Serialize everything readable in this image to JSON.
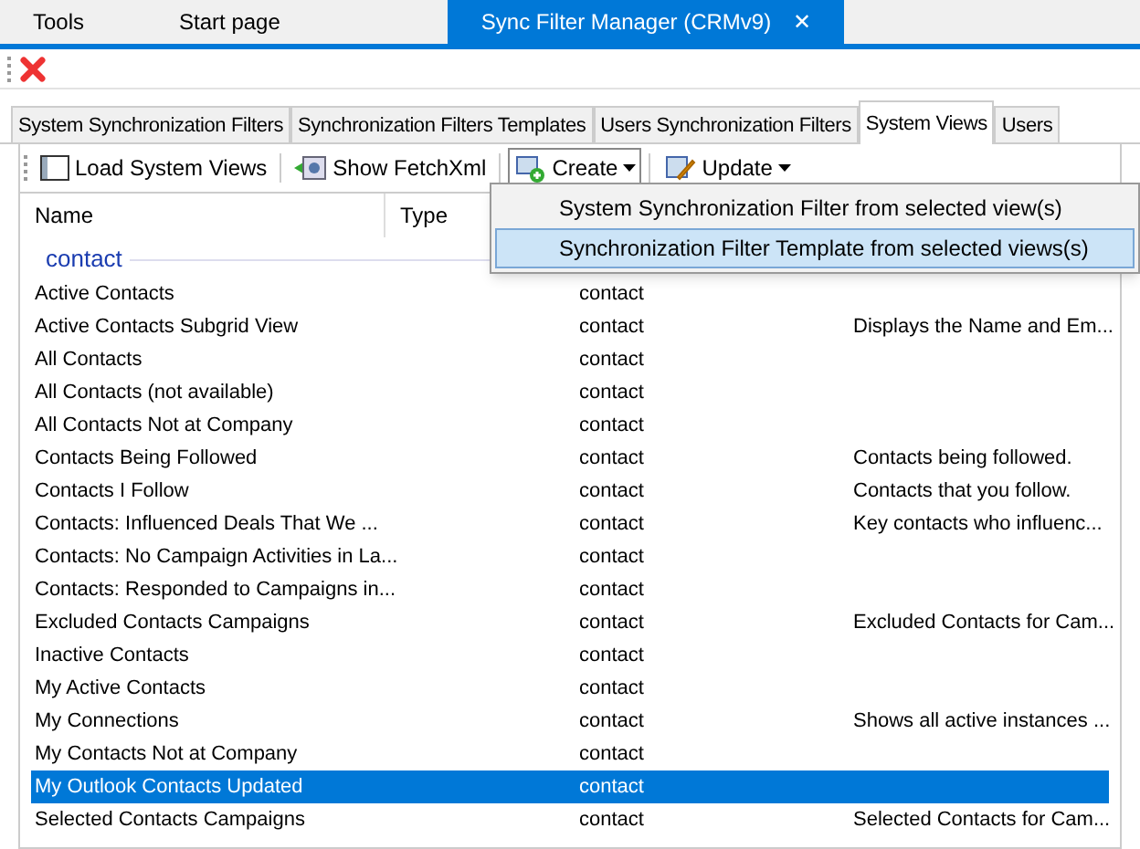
{
  "doc_tabs": [
    {
      "label": "Tools",
      "selected": false
    },
    {
      "label": "Start page",
      "selected": false
    },
    {
      "label": "Sync Filter Manager (CRMv9)",
      "selected": true,
      "close": "✕"
    }
  ],
  "tabs": [
    {
      "label": "System Synchronization Filters",
      "selected": false
    },
    {
      "label": "Synchronization Filters Templates",
      "selected": false
    },
    {
      "label": "Users Synchronization Filters",
      "selected": false
    },
    {
      "label": "System Views",
      "selected": true
    },
    {
      "label": "Users",
      "selected": false
    }
  ],
  "toolbar": [
    {
      "kind": "load",
      "label": "Load System Views"
    },
    {
      "kind": "fetch",
      "label": "Show FetchXml"
    },
    {
      "kind": "create",
      "label": "Create",
      "open": true
    },
    {
      "kind": "update",
      "label": "Update",
      "open": false
    }
  ],
  "menu": [
    {
      "label": "System Synchronization Filter from selected view(s)",
      "selected": false
    },
    {
      "label": "Synchronization Filter Template from selected views(s)",
      "selected": true
    }
  ],
  "table": {
    "columns": [
      "Name",
      "Type"
    ],
    "group": "contact",
    "rows": [
      {
        "name": "Active Contacts",
        "type": "contact",
        "selected": false
      },
      {
        "name": "Active Contacts Subgrid View",
        "type": "contact",
        "description": "Displays the Name and Em...",
        "selected": false
      },
      {
        "name": "All Contacts",
        "type": "contact",
        "selected": false
      },
      {
        "name": "All Contacts (not available)",
        "type": "contact",
        "selected": false
      },
      {
        "name": "All Contacts Not at Company",
        "type": "contact",
        "selected": false
      },
      {
        "name": "Contacts Being Followed",
        "type": "contact",
        "description": "Contacts being followed.",
        "selected": false
      },
      {
        "name": "Contacts I Follow",
        "type": "contact",
        "description": "Contacts that you follow.",
        "selected": false
      },
      {
        "name": "Contacts: Influenced Deals That We ...",
        "type": "contact",
        "description": "Key contacts who influenc...",
        "selected": false
      },
      {
        "name": "Contacts: No Campaign Activities in La...",
        "type": "contact",
        "selected": false
      },
      {
        "name": "Contacts: Responded to Campaigns in...",
        "type": "contact",
        "selected": false
      },
      {
        "name": "Excluded Contacts Campaigns",
        "type": "contact",
        "description": "Excluded Contacts for Cam...",
        "selected": false
      },
      {
        "name": "Inactive Contacts",
        "type": "contact",
        "selected": false
      },
      {
        "name": "My Active Contacts",
        "type": "contact",
        "selected": false
      },
      {
        "name": "My Connections",
        "type": "contact",
        "description": "Shows all active instances ...",
        "selected": false
      },
      {
        "name": "My Contacts Not at Company",
        "type": "contact",
        "selected": false
      },
      {
        "name": "My Outlook Contacts Updated",
        "type": "contact",
        "selected": true
      },
      {
        "name": "Selected Contacts Campaigns",
        "type": "contact",
        "description": "Selected Contacts for Cam...",
        "selected": false
      }
    ]
  }
}
